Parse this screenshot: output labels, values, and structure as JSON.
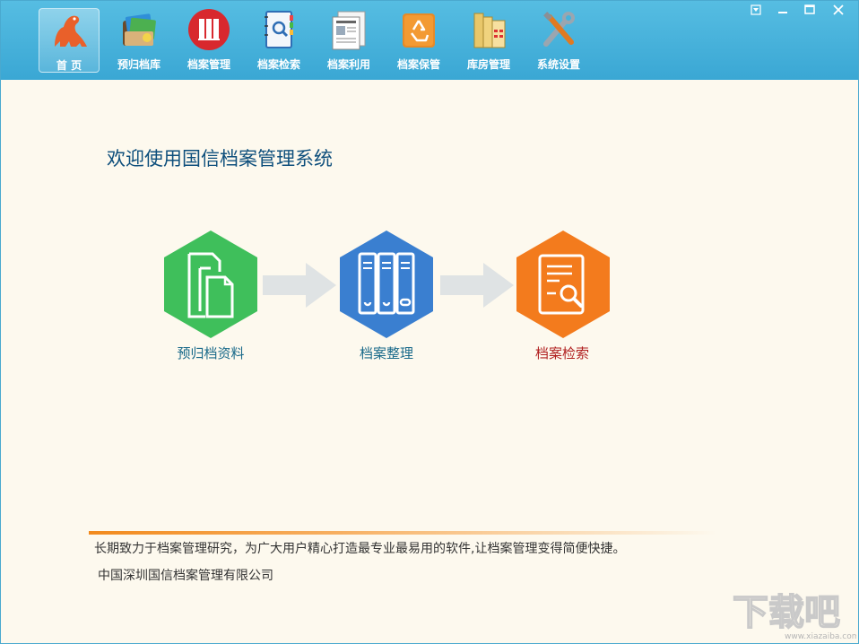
{
  "toolbar": {
    "items": [
      {
        "label": "首  页",
        "icon": "dinosaur-home-icon",
        "active": true
      },
      {
        "label": "预归档库",
        "icon": "photo-stack-icon"
      },
      {
        "label": "档案管理",
        "icon": "binders-icon"
      },
      {
        "label": "档案检索",
        "icon": "notebook-search-icon"
      },
      {
        "label": "档案利用",
        "icon": "newspaper-icon"
      },
      {
        "label": "档案保管",
        "icon": "recycle-box-icon"
      },
      {
        "label": "库房管理",
        "icon": "warehouse-icon"
      },
      {
        "label": "系统设置",
        "icon": "tools-icon"
      }
    ]
  },
  "window_controls": [
    "menu-dropdown-icon",
    "minimize-icon",
    "maximize-icon",
    "close-icon"
  ],
  "main": {
    "welcome": "欢迎使用国信档案管理系统",
    "steps": [
      {
        "label": "预归档资料",
        "icon": "documents-icon",
        "color": "#3fbf5b",
        "label_color": "#1a6a8a"
      },
      {
        "label": "档案整理",
        "icon": "binders-icon",
        "color": "#3a7fd0",
        "label_color": "#1a6a8a"
      },
      {
        "label": "档案检索",
        "icon": "document-search-icon",
        "color": "#f37b1d",
        "label_color": "#b01e1e"
      }
    ],
    "slogan": "长期致力于档案管理研究，为广大用户精心打造最专业最易用的软件,让档案管理变得简便快捷。",
    "company": "中国深圳国信档案管理有限公司"
  },
  "watermark": {
    "text": "下载吧",
    "url": "www.xiazaiba.com"
  },
  "colors": {
    "toolbar_bg": "#46b3dc",
    "page_bg": "#fdf9ee",
    "accent_orange": "#f28a1c"
  }
}
